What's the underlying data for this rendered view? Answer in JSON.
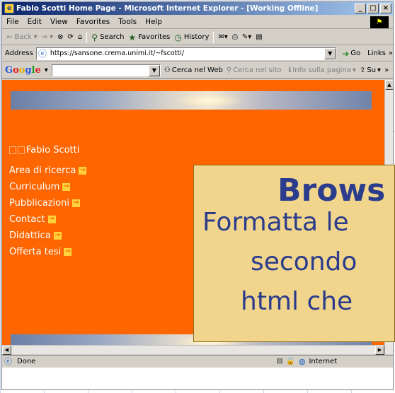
{
  "window": {
    "title": "Fabio Scotti Home Page - Microsoft Internet Explorer - [Working Offline]",
    "controls": [
      "_",
      "□",
      "×"
    ]
  },
  "menu": [
    "File",
    "Edit",
    "View",
    "Favorites",
    "Tools",
    "Help"
  ],
  "toolbar": {
    "back": "Back",
    "search": "Search",
    "favorites": "Favorites",
    "history": "History"
  },
  "address": {
    "label": "Address",
    "url": "https://sansone.crema.unimi.it/~fscotti/",
    "go": "Go",
    "links": "Links"
  },
  "googlebar": {
    "logo": [
      "G",
      "o",
      "o",
      "g",
      "l",
      "e"
    ],
    "search_web": "Cerca nel Web",
    "search_site": "Cerca nel sito",
    "page_info": "Info sulla pagina",
    "up": "Su"
  },
  "page": {
    "site_title": "Fabio Scotti",
    "nav_items": [
      "Area di ricerca",
      "Curriculum",
      "Pubblicazioni",
      "Contact",
      "Didattica",
      "Offerta tesi"
    ]
  },
  "overlay": {
    "title": "Brows",
    "lines": [
      "Formatta le",
      "secondo",
      "html che"
    ]
  },
  "status": {
    "text": "Done",
    "zone": "Internet"
  },
  "colors": {
    "page_bg": "#ff6600",
    "overlay_bg": "#f1d58c",
    "overlay_text": "#2b3c8c"
  }
}
